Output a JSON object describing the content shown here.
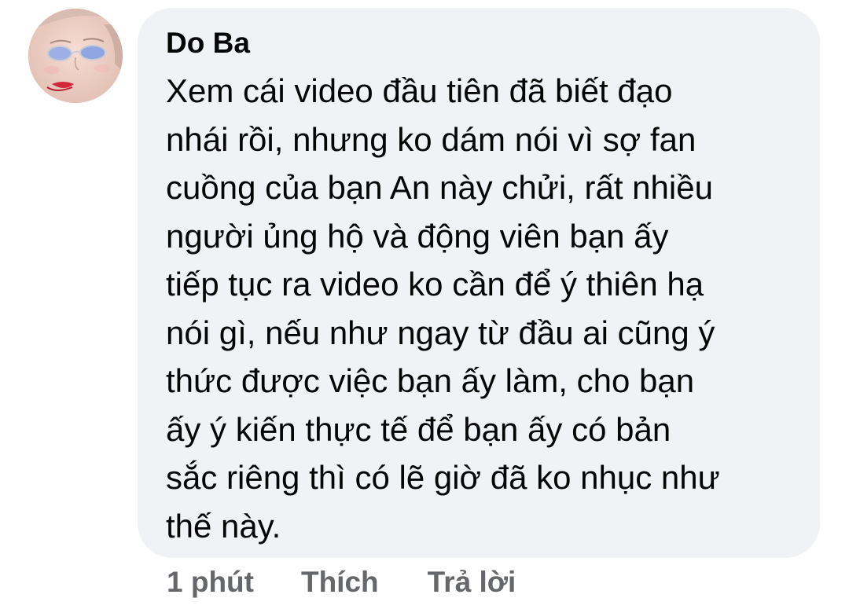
{
  "comment": {
    "author": "Do Ba",
    "text_lines": [
      "Xem cái video đầu tiên đã biết đạo",
      "nhái rồi, nhưng ko dám nói vì sợ fan",
      "cuồng của bạn An này chửi, rất nhiều",
      "người ủng hộ và động viên bạn ấy",
      "tiếp tục ra video ko cần để ý thiên hạ",
      "nói gì, nếu như ngay từ đầu ai cũng ý",
      "thức được việc bạn ấy làm, cho bạn",
      "ấy ý kiến thực tế để bạn ấy có bản",
      "sắc riêng thì có lẽ giờ đã ko nhục như",
      "thế này."
    ],
    "avatar_icon": "user-avatar-photo"
  },
  "actions": {
    "time": "1 phút",
    "like_label": "Thích",
    "reply_label": "Trả lời"
  },
  "colors": {
    "bubble_bg": "#f0f2f5",
    "text": "#050505",
    "meta": "#65676b"
  }
}
